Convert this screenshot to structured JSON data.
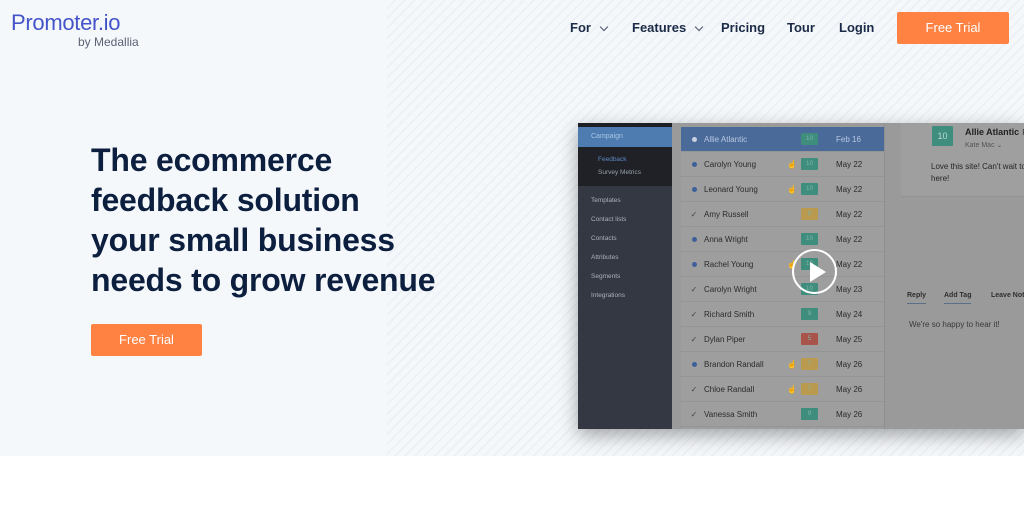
{
  "brand": {
    "name": "Promoter.io",
    "tagline": "by Medallia",
    "color": "#4453c8"
  },
  "nav": {
    "items": [
      {
        "label": "For",
        "has_dropdown": true
      },
      {
        "label": "Features",
        "has_dropdown": true
      },
      {
        "label": "Pricing",
        "has_dropdown": false
      },
      {
        "label": "Tour",
        "has_dropdown": false
      },
      {
        "label": "Login",
        "has_dropdown": false
      }
    ],
    "cta_label": "Free Trial",
    "cta_color": "#ff8243"
  },
  "hero": {
    "headline_lines": [
      "The ecommerce",
      "feedback solution",
      "your small business",
      "needs to grow revenue"
    ],
    "cta_label": "Free Trial"
  },
  "app_preview": {
    "video_icon": "play-icon",
    "sidebar": {
      "active_section": "Campaign",
      "sub_items": [
        "Feedback",
        "Survey Metrics"
      ],
      "active_sub_item": "Feedback",
      "items": [
        "Templates",
        "Contact lists",
        "Contacts",
        "Attributes",
        "Segments",
        "Integrations"
      ]
    },
    "responses": [
      {
        "status": "dot",
        "name": "Allie Atlantic",
        "hand": "",
        "score": "10",
        "score_color": "#3f8e7d",
        "date": "Feb 16",
        "selected": true
      },
      {
        "status": "dot",
        "name": "Carolyn Young",
        "hand": "2",
        "score": "10",
        "score_color": "#3f8e7d",
        "date": "May 22",
        "selected": false
      },
      {
        "status": "dot",
        "name": "Leonard Young",
        "hand": "3",
        "score": "10",
        "score_color": "#3f8e7d",
        "date": "May 22",
        "selected": false
      },
      {
        "status": "check",
        "name": "Amy Russell",
        "hand": "",
        "score": "8",
        "score_color": "#b99a4e",
        "date": "May 22",
        "selected": false
      },
      {
        "status": "dot",
        "name": "Anna Wright",
        "hand": "",
        "score": "10",
        "score_color": "#3f8e7d",
        "date": "May 22",
        "selected": false
      },
      {
        "status": "dot",
        "name": "Rachel Young",
        "hand": "1",
        "score": "10",
        "score_color": "#3f8e7d",
        "date": "May 22",
        "selected": false
      },
      {
        "status": "check",
        "name": "Carolyn Wright",
        "hand": "",
        "score": "10",
        "score_color": "#3f8e7d",
        "date": "May 23",
        "selected": false
      },
      {
        "status": "check",
        "name": "Richard Smith",
        "hand": "",
        "score": "9",
        "score_color": "#3f8e7d",
        "date": "May 24",
        "selected": false
      },
      {
        "status": "check",
        "name": "Dylan Piper",
        "hand": "",
        "score": "5",
        "score_color": "#a8544a",
        "date": "May 25",
        "selected": false
      },
      {
        "status": "dot",
        "name": "Brandon Randall",
        "hand": "1",
        "score": "7",
        "score_color": "#b99a4e",
        "date": "May 26",
        "selected": false
      },
      {
        "status": "check",
        "name": "Chloe Randall",
        "hand": "2",
        "score": "7",
        "score_color": "#b99a4e",
        "date": "May 26",
        "selected": false
      },
      {
        "status": "check",
        "name": "Vanessa Smith",
        "hand": "",
        "score": "9",
        "score_color": "#3f8e7d",
        "date": "May 26",
        "selected": false
      }
    ],
    "detail": {
      "score": "10",
      "name": "Allie Atlantic",
      "name_suffix": "Feb",
      "owner": "Kate Mac ⌄",
      "message": "Love this site! Can't wait to shop here!",
      "tabs": [
        "Reply",
        "Add Tag",
        "Leave Note"
      ],
      "reply_text": "We're so happy to hear it!"
    }
  }
}
